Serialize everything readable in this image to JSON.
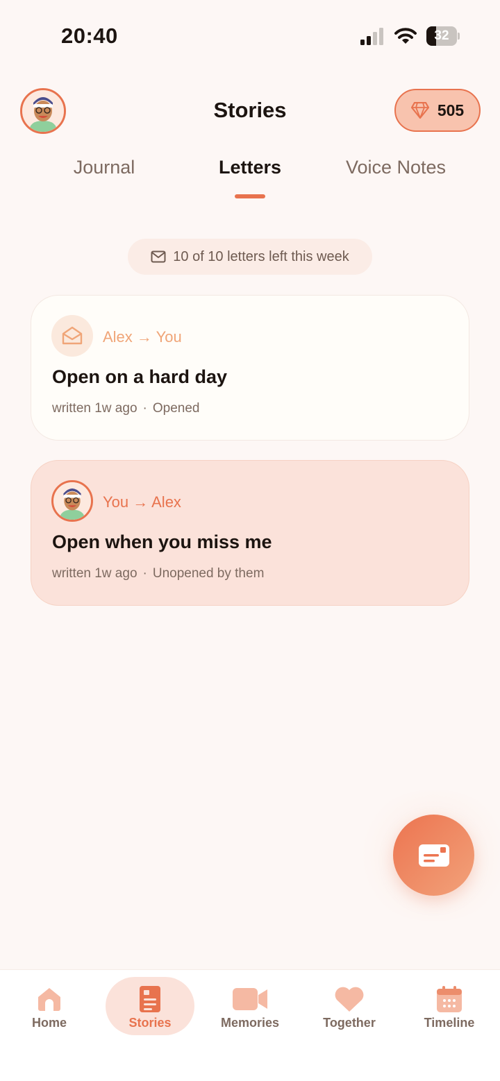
{
  "status_bar": {
    "time": "20:40",
    "battery_level": "32",
    "battery_fraction": 0.32,
    "icons": [
      "signal-icon",
      "wifi-icon",
      "battery-icon"
    ]
  },
  "header": {
    "title": "Stories",
    "gems": "505",
    "icons": [
      "avatar",
      "gem-icon"
    ]
  },
  "tabs": [
    {
      "label": "Journal",
      "active": false
    },
    {
      "label": "Letters",
      "active": true
    },
    {
      "label": "Voice Notes",
      "active": false
    }
  ],
  "quota": {
    "text": "10 of 10 letters left this week",
    "icon": "mail-icon"
  },
  "letters": [
    {
      "from": "Alex → You",
      "title": "Open on a hard day",
      "written": "written 1w ago",
      "status": "Opened",
      "icon": "open-envelope-icon"
    },
    {
      "from": "You → Alex",
      "title": "Open when you miss me",
      "written": "written 1w ago",
      "status": "Unopened by them",
      "icon": "avatar"
    }
  ],
  "fab": {
    "icon": "compose-letter-icon"
  },
  "nav": [
    {
      "label": "Home",
      "icon": "home-icon",
      "active": false
    },
    {
      "label": "Stories",
      "icon": "stories-icon",
      "active": true
    },
    {
      "label": "Memories",
      "icon": "video-camera-icon",
      "active": false
    },
    {
      "label": "Together",
      "icon": "heart-icon",
      "active": false
    },
    {
      "label": "Timeline",
      "icon": "calendar-icon",
      "active": false
    }
  ],
  "colors": {
    "accent": "#e8734e",
    "accent_light": "#fbe2da",
    "background": "#fdf7f5",
    "text_primary": "#1c1410",
    "text_muted": "#7d6a60",
    "nav_icon_inactive": "#f5b9a3"
  }
}
